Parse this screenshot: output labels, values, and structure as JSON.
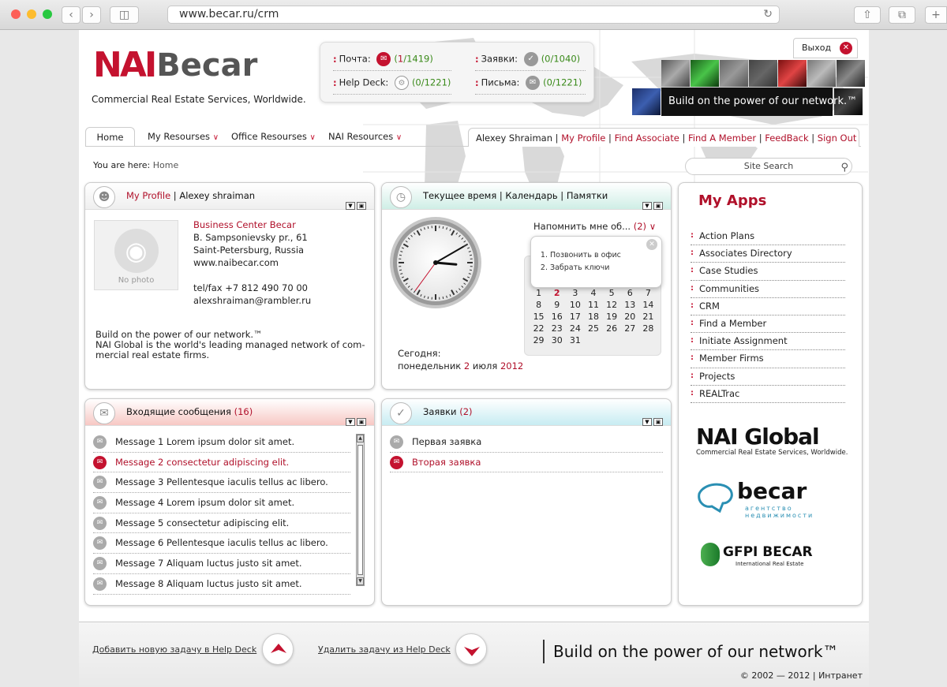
{
  "browser": {
    "url": "www.becar.ru/crm"
  },
  "header": {
    "logo_nai": "NAI",
    "logo_becar": "Becar",
    "tagline": "Commercial Real Estate Services, Worldwide.",
    "exit_label": "Выход",
    "banner": "Build on the power of our network.™"
  },
  "status": {
    "mail_label": "Почта:",
    "mail_count_new": "1",
    "mail_count_total": "/1419",
    "requests_label": "Заявки:",
    "requests_count": "(0/1040)",
    "helpdesk_label": "Help Deck:",
    "helpdesk_count": "(0/1221)",
    "letters_label": "Письма:",
    "letters_count": "(0/1221)"
  },
  "nav": {
    "tabs": [
      "Home",
      "My Resourses",
      "Office Resourses",
      "NAI Resources"
    ],
    "user": "Alexey Shraiman",
    "links": [
      "My Profile",
      "Find Associate",
      "Find A Member",
      "FeedBack",
      "Sign Out"
    ]
  },
  "breadcrumb": {
    "prefix": "You are here:",
    "current": "Home"
  },
  "search": {
    "placeholder": "Site Search"
  },
  "profile": {
    "title_link": "My Profile",
    "title_name": "Alexey shraiman",
    "nophoto": "No photo",
    "company": "Business Center Becar",
    "address1": "B. Sampsonievsky pr., 61",
    "address2": "Saint-Petersburg, Russia",
    "website": "www.naibecar.com",
    "phone": "tel/fax +7 812 490 70 00",
    "email": "alexshraiman@rambler.ru",
    "about1": "Build on the power of our network.™",
    "about2": "NAI Global is the world's leading managed network of com-",
    "about3": "mercial real estate firms."
  },
  "time_widget": {
    "title": "Текущее время  | Календарь | Памятки",
    "remind_label": "Напомнить мне об...",
    "remind_count": "(2)",
    "reminders": [
      "Позвонить в офис",
      "Забрать ключи"
    ],
    "today_label": "Сегодня:",
    "today_weekday": "понедельник",
    "today_day": "2",
    "today_month": "июля",
    "today_year": "2012",
    "clock_hour": 3,
    "clock_minute": 10,
    "clock_second": 36,
    "calendar_days": [
      "1",
      "2",
      "3",
      "4",
      "5",
      "6",
      "7",
      "8",
      "9",
      "10",
      "11",
      "12",
      "13",
      "14",
      "15",
      "16",
      "17",
      "18",
      "19",
      "20",
      "21",
      "22",
      "23",
      "24",
      "25",
      "26",
      "27",
      "28",
      "29",
      "30",
      "31"
    ],
    "calendar_today": "2"
  },
  "inbox": {
    "title": "Входящие сообщения",
    "count": "(16)",
    "messages": [
      "Message 1 Lorem ipsum dolor sit amet.",
      "Message 2 consectetur adipiscing elit.",
      "Message 3 Pellentesque iaculis tellus ac libero.",
      "Message 4 Lorem ipsum dolor sit amet.",
      "Message 5 consectetur adipiscing elit.",
      "Message 6 Pellentesque iaculis tellus ac libero.",
      "Message 7 Aliquam luctus justo sit amet.",
      "Message 8 Aliquam luctus justo sit amet."
    ],
    "active_index": 1
  },
  "requests": {
    "title": "Заявки",
    "count": "(2)",
    "items": [
      "Первая заявка",
      "Вторая заявка"
    ],
    "active_index": 1
  },
  "apps": {
    "title": "My Apps",
    "items": [
      "Action Plans",
      "Associates Directory",
      "Case Studies",
      "Communities",
      "CRM",
      "Find a Member",
      "Initiate Assignment",
      "Member Firms",
      "Projects",
      "REALTrac"
    ],
    "logos": {
      "nai_global": "NAI Global",
      "nai_global_sub": "Commercial Real Estate Services, Worldwide.",
      "becar": "becar",
      "becar_sub1": "агентство",
      "becar_sub2": "недвижимости",
      "gfpi": "GFPI BECAR",
      "gfpi_sub": "International Real Estate"
    }
  },
  "footer": {
    "add_task": "Добавить новую задачу в Help Deck",
    "remove_task": "Удалить задачу из Help Deck",
    "slogan": "Build on the power of our network™",
    "copyright": "© 2002 — 2012 | Интранет"
  },
  "colors": {
    "accent": "#c4122f",
    "link": "#b0102a",
    "count_green": "#3a8a1a"
  }
}
